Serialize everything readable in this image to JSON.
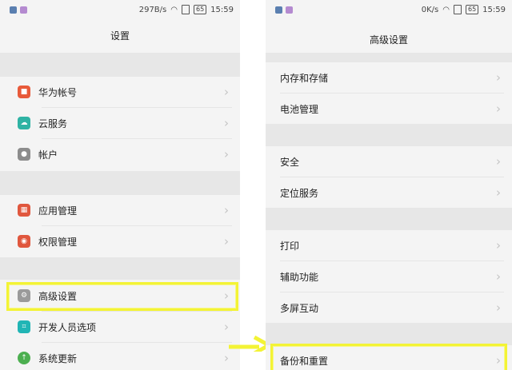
{
  "left": {
    "status": {
      "speed": "297B/s",
      "battery": "65",
      "time": "15:59"
    },
    "title": "设置",
    "items": [
      {
        "label": "华为帐号",
        "icon": "huawei-account-icon",
        "color": "#e85a3a"
      },
      {
        "label": "云服务",
        "icon": "cloud-icon",
        "color": "#2fb3a4"
      },
      {
        "label": "帐户",
        "icon": "user-icon",
        "color": "#8c8c8c"
      },
      {
        "label": "应用管理",
        "icon": "apps-icon",
        "color": "#e0573e"
      },
      {
        "label": "权限管理",
        "icon": "permission-icon",
        "color": "#e0573e"
      },
      {
        "label": "高级设置",
        "icon": "gear-icon",
        "color": "#9a9a9a"
      },
      {
        "label": "开发人员选项",
        "icon": "developer-icon",
        "color": "#21b5b5"
      },
      {
        "label": "系统更新",
        "icon": "update-icon",
        "color": "#4caf50"
      }
    ]
  },
  "right": {
    "status": {
      "speed": "0K/s",
      "battery": "65",
      "time": "15:59"
    },
    "title": "高级设置",
    "items": [
      {
        "label": "内存和存储"
      },
      {
        "label": "电池管理"
      },
      {
        "label": "安全"
      },
      {
        "label": "定位服务"
      },
      {
        "label": "打印"
      },
      {
        "label": "辅助功能"
      },
      {
        "label": "多屏互动"
      },
      {
        "label": "备份和重置"
      }
    ]
  },
  "colors": {
    "highlight": "#f3f335",
    "accent": "#f7f78a"
  }
}
